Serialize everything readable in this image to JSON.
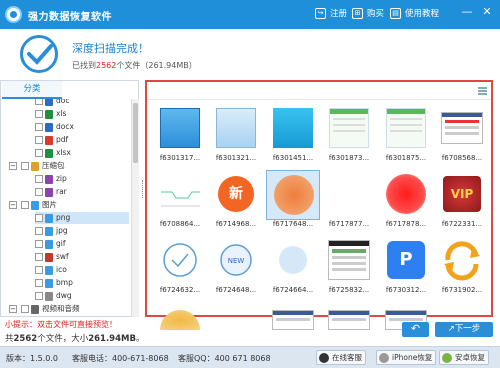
{
  "app": {
    "title": "强力数据恢复软件"
  },
  "toolbar": {
    "register": "注册",
    "buy": "购买",
    "tutorial": "使用教程"
  },
  "window": {
    "minimize": "—",
    "close": "✕"
  },
  "status": {
    "title": "深度扫描完成！",
    "sub_prefix": "已找到",
    "count": "2562",
    "sub_suffix": "个文件（261.94MB）"
  },
  "sidebar": {
    "tab": "分类",
    "items": [
      {
        "label": "doc",
        "icon_color": "#2b6cc4"
      },
      {
        "label": "xls",
        "icon_color": "#1f8f3e"
      },
      {
        "label": "docx",
        "icon_color": "#2b6cc4"
      },
      {
        "label": "pdf",
        "icon_color": "#d83b2b"
      },
      {
        "label": "xlsx",
        "icon_color": "#1f8f3e"
      },
      {
        "label": "压缩包",
        "icon_color": "#e0a020"
      },
      {
        "label": "zip",
        "icon_color": "#8e44ad"
      },
      {
        "label": "rar",
        "icon_color": "#8e44ad"
      },
      {
        "label": "图片",
        "icon_color": "#3b9be0"
      },
      {
        "label": "png",
        "icon_color": "#3b9be0"
      },
      {
        "label": "jpg",
        "icon_color": "#3b9be0"
      },
      {
        "label": "gif",
        "icon_color": "#3b9be0"
      },
      {
        "label": "swf",
        "icon_color": "#c0392b"
      },
      {
        "label": "ico",
        "icon_color": "#3b9be0"
      },
      {
        "label": "bmp",
        "icon_color": "#3b9be0"
      },
      {
        "label": "dwg",
        "icon_color": "#888888"
      },
      {
        "label": "视频和音频",
        "icon_color": "#666666"
      }
    ]
  },
  "grid": {
    "cells": [
      {
        "label": "f6301317...",
        "thumb": "blue-square"
      },
      {
        "label": "f6301321...",
        "thumb": "lightblue-square"
      },
      {
        "label": "f6301451...",
        "thumb": "cyan-square"
      },
      {
        "label": "f6301873...",
        "thumb": "green-doc"
      },
      {
        "label": "f6301875...",
        "thumb": "green-doc"
      },
      {
        "label": "f6708568...",
        "thumb": "screenshot"
      },
      {
        "label": "f6708864...",
        "thumb": "line-graph"
      },
      {
        "label": "f6714968...",
        "thumb": "xin-badge"
      },
      {
        "label": "f6717648...",
        "thumb": "orange-blur"
      },
      {
        "label": "f6717877...",
        "thumb": "blank"
      },
      {
        "label": "f6717878...",
        "thumb": "red-blur"
      },
      {
        "label": "f6722331...",
        "thumb": "vip-badge"
      },
      {
        "label": "f6724632...",
        "thumb": "check-circle"
      },
      {
        "label": "f6724648...",
        "thumb": "new-circle"
      },
      {
        "label": "f6724664...",
        "thumb": "plain-circle"
      },
      {
        "label": "f6725832...",
        "thumb": "screenshot2"
      },
      {
        "label": "f6730312...",
        "thumb": "p-app"
      },
      {
        "label": "f6731902...",
        "thumb": "refresh-orange"
      },
      {
        "label": "",
        "thumb": "partial-orange"
      },
      {
        "label": "",
        "thumb": "partial-blank"
      },
      {
        "label": "",
        "thumb": "partial-screen"
      },
      {
        "label": "",
        "thumb": "partial-screen"
      },
      {
        "label": "",
        "thumb": "partial-screen"
      },
      {
        "label": "",
        "thumb": "partial-blank"
      }
    ],
    "selected_index": 8
  },
  "tip": "小提示：双击文件可直接预览！",
  "summary": {
    "prefix": "共",
    "count": "2562",
    "middle": "个文件，大小",
    "size": "261.94MB",
    "suffix": "。"
  },
  "buttons": {
    "back": "↶",
    "next": "↗下一步"
  },
  "footer": {
    "version": "版本：1.5.0.0",
    "phone": "客服电话：400-671-8068",
    "qq": "客服QQ：400 671 8068",
    "online_service": "在线客服",
    "iphone_recovery": "iPhone恢复",
    "android_recovery": "安卓恢复"
  }
}
